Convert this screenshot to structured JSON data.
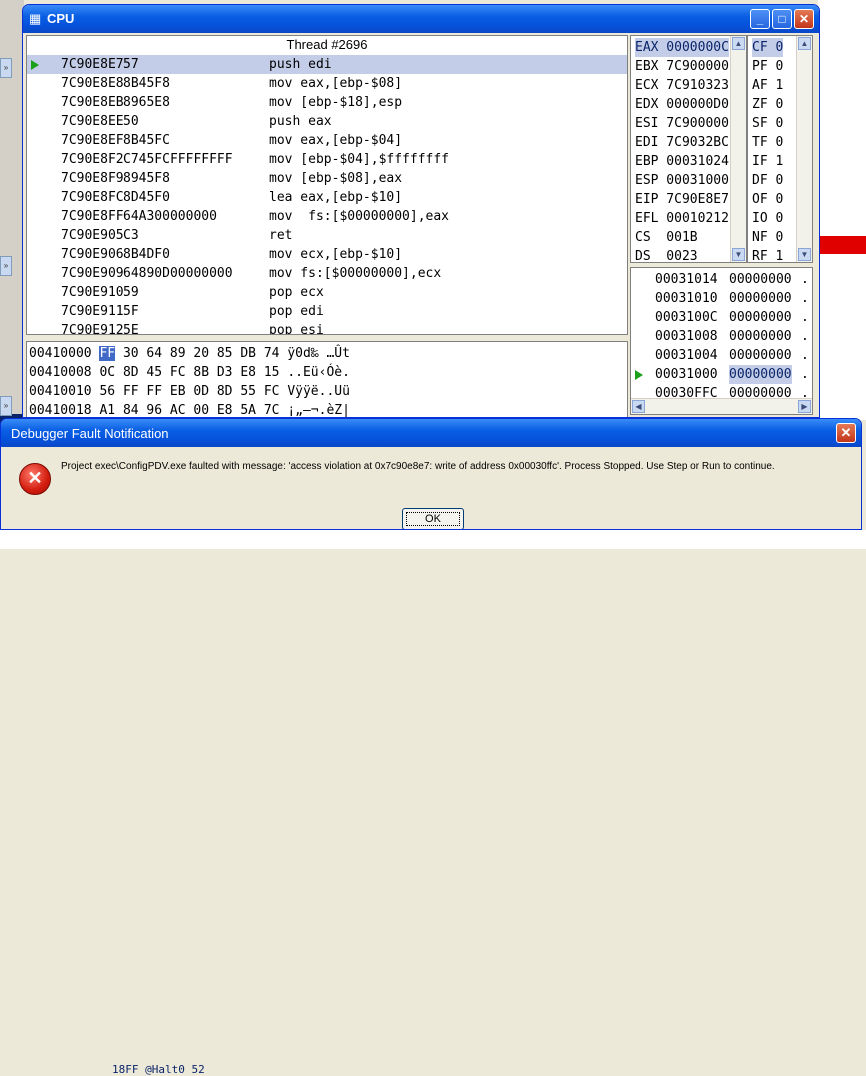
{
  "cpu_window": {
    "title": "CPU",
    "thread": "Thread #2696",
    "disasm": [
      {
        "addr": "7C90E8E7",
        "bytes": "57",
        "instr": "push edi",
        "current": true
      },
      {
        "addr": "7C90E8E8",
        "bytes": "8B45F8",
        "instr": "mov eax,[ebp-$08]"
      },
      {
        "addr": "7C90E8EB",
        "bytes": "8965E8",
        "instr": "mov [ebp-$18],esp"
      },
      {
        "addr": "7C90E8EE",
        "bytes": "50",
        "instr": "push eax"
      },
      {
        "addr": "7C90E8EF",
        "bytes": "8B45FC",
        "instr": "mov eax,[ebp-$04]"
      },
      {
        "addr": "7C90E8F2",
        "bytes": "C745FCFFFFFFFF",
        "instr": "mov [ebp-$04],$ffffffff"
      },
      {
        "addr": "7C90E8F9",
        "bytes": "8945F8",
        "instr": "mov [ebp-$08],eax"
      },
      {
        "addr": "7C90E8FC",
        "bytes": "8D45F0",
        "instr": "lea eax,[ebp-$10]"
      },
      {
        "addr": "7C90E8FF",
        "bytes": "64A300000000",
        "instr": "mov  fs:[$00000000],eax"
      },
      {
        "addr": "7C90E905",
        "bytes": "C3",
        "instr": "ret"
      },
      {
        "addr": "7C90E906",
        "bytes": "8B4DF0",
        "instr": "mov ecx,[ebp-$10]"
      },
      {
        "addr": "7C90E909",
        "bytes": "64890D00000000",
        "instr": "mov fs:[$00000000],ecx"
      },
      {
        "addr": "7C90E910",
        "bytes": "59",
        "instr": "pop ecx"
      },
      {
        "addr": "7C90E911",
        "bytes": "5F",
        "instr": "pop edi"
      },
      {
        "addr": "7C90E912",
        "bytes": "5E",
        "instr": "pop esi"
      }
    ],
    "registers": [
      "EAX 0000000C",
      "EBX 7C900000",
      "ECX 7C910323",
      "EDX 000000D0",
      "ESI 7C900000",
      "EDI 7C9032BC",
      "EBP 00031024",
      "ESP 00031000",
      "EIP 7C90E8E7",
      "EFL 00010212",
      "CS  001B",
      "DS  0023"
    ],
    "flags": [
      "CF 0",
      "PF 0",
      "AF 1",
      "ZF 0",
      "SF 0",
      "TF 0",
      "IF 1",
      "DF 0",
      "OF 0",
      "IO 0",
      "NF 0",
      "RF 1"
    ],
    "stack": [
      {
        "addr": "00031014",
        "val": "00000000",
        "ch": "."
      },
      {
        "addr": "00031010",
        "val": "00000000",
        "ch": "."
      },
      {
        "addr": "0003100C",
        "val": "00000000",
        "ch": "."
      },
      {
        "addr": "00031008",
        "val": "00000000",
        "ch": "."
      },
      {
        "addr": "00031004",
        "val": "00000000",
        "ch": "."
      },
      {
        "addr": "00031000",
        "val": "00000000",
        "ch": ".",
        "current": true
      },
      {
        "addr": "00030FFC",
        "val": "00000000",
        "ch": "."
      }
    ],
    "hex_dump": [
      {
        "addr": "00410000",
        "first": "FF",
        "rest": "30 64 89 20 85 DB 74",
        "ascii": "ÿ0d‰ …Ût"
      },
      {
        "addr": "00410008",
        "first": "0C",
        "rest": "8D 45 FC 8B D3 E8 15",
        "ascii": "..Eü‹Óè."
      },
      {
        "addr": "00410010",
        "first": "56",
        "rest": "FF FF EB 0D 8D 55 FC",
        "ascii": "Vÿÿë..Uü"
      },
      {
        "addr": "00410018",
        "first": "A1",
        "rest": "84 96 AC 00 E8 5A 7C",
        "ascii": "¡„–¬.èZ|"
      }
    ]
  },
  "fault_dialog": {
    "title": "Debugger Fault Notification",
    "message": "Project exec\\ConfigPDV.exe faulted with message: 'access violation at 0x7c90e8e7: write of address 0x00030ffc'. Process Stopped. Use Step or Run to continue.",
    "ok_label": "OK"
  },
  "background": {
    "bottom_text": "18FF  @Halt0  52"
  },
  "colors": {
    "title_blue": "#0a5fe4",
    "selection": "#c4cde8",
    "hex_selection": "#4169c8",
    "error_red": "#d21c0e"
  }
}
